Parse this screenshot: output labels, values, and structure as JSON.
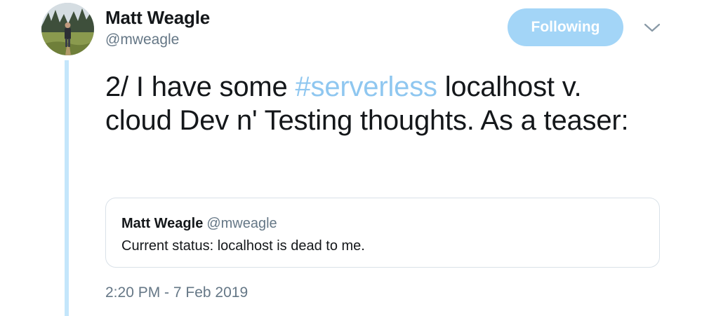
{
  "author": {
    "display_name": "Matt Weagle",
    "handle": "@mweagle"
  },
  "follow_button": {
    "label": "Following"
  },
  "menu": {
    "icon": "chevron-down-icon"
  },
  "tweet": {
    "text_before": "2/ I have some ",
    "hashtag": "#serverless",
    "text_after": " localhost v. cloud Dev n' Testing thoughts. As a teaser:"
  },
  "quoted_tweet": {
    "display_name": "Matt Weagle",
    "handle": "@mweagle",
    "text": "Current status: localhost is dead to me."
  },
  "timestamp": "2:20 PM - 7 Feb 2019",
  "colors": {
    "accent": "#1da1f2",
    "following_button": "#a3d5f7",
    "hashtag": "#8fc7f0",
    "thread_line": "#c4e6fb",
    "secondary_text": "#657786",
    "primary_text": "#14171a"
  }
}
